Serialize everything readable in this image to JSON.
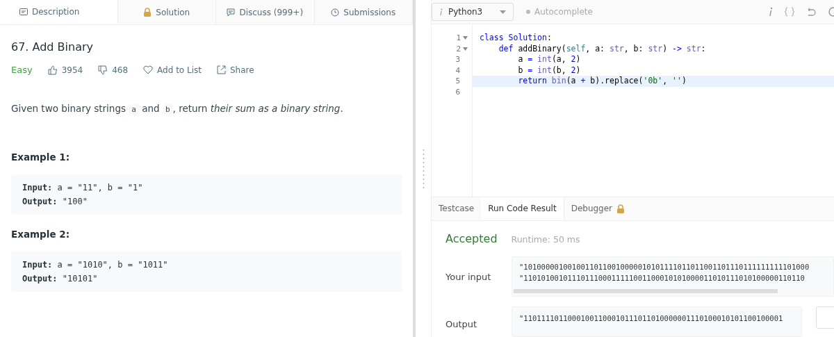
{
  "left_tabs": [
    {
      "label": "Description",
      "selected": true
    },
    {
      "label": "Solution",
      "selected": false
    },
    {
      "label": "Discuss (999+)",
      "selected": false
    },
    {
      "label": "Submissions",
      "selected": false
    }
  ],
  "problem": {
    "title": "67. Add Binary",
    "difficulty": "Easy",
    "likes": "3954",
    "dislikes": "468",
    "add_to_list": "Add to List",
    "share": "Share",
    "description": [
      {
        "kind": "text",
        "t": "Given two binary strings "
      },
      {
        "kind": "code",
        "t": "a"
      },
      {
        "kind": "text",
        "t": " and "
      },
      {
        "kind": "code",
        "t": "b"
      },
      {
        "kind": "text",
        "t": ", return "
      },
      {
        "kind": "italic",
        "t": "their sum as a binary string"
      },
      {
        "kind": "text",
        "t": "."
      }
    ],
    "examples": [
      {
        "title": "Example 1:",
        "lines": [
          {
            "label": "Input:",
            "value": " a = \"11\", b = \"1\""
          },
          {
            "label": "Output:",
            "value": " \"100\""
          }
        ]
      },
      {
        "title": "Example 2:",
        "lines": [
          {
            "label": "Input:",
            "value": " a = \"1010\", b = \"1011\""
          },
          {
            "label": "Output:",
            "value": " \"10101\""
          }
        ]
      }
    ]
  },
  "editor_toolbar": {
    "language": "Python3",
    "autocomplete": "Autocomplete"
  },
  "code_lines": [
    {
      "number": "1",
      "foldable": true,
      "highlighted": false,
      "tokens": [
        {
          "kind": "kw",
          "t": "class "
        },
        {
          "kind": "kw",
          "t": "Solution"
        },
        {
          "kind": "plain",
          "t": ":"
        }
      ]
    },
    {
      "number": "2",
      "foldable": true,
      "highlighted": false,
      "tokens": [
        {
          "kind": "kw",
          "t": "    def "
        },
        {
          "kind": "plain",
          "t": "addBinary("
        },
        {
          "kind": "var",
          "t": "self"
        },
        {
          "kind": "plain",
          "t": ", a: "
        },
        {
          "kind": "builtin",
          "t": "str"
        },
        {
          "kind": "plain",
          "t": ", b: "
        },
        {
          "kind": "builtin",
          "t": "str"
        },
        {
          "kind": "plain",
          "t": ") "
        },
        {
          "kind": "kw",
          "t": "->"
        },
        {
          "kind": "builtin",
          "t": " str"
        },
        {
          "kind": "plain",
          "t": ":"
        }
      ]
    },
    {
      "number": "3",
      "foldable": false,
      "highlighted": false,
      "tokens": [
        {
          "kind": "plain",
          "t": "        a "
        },
        {
          "kind": "kw",
          "t": "="
        },
        {
          "kind": "builtin",
          "t": " int"
        },
        {
          "kind": "plain",
          "t": "(a, "
        },
        {
          "kind": "num",
          "t": "2"
        },
        {
          "kind": "plain",
          "t": ")"
        }
      ]
    },
    {
      "number": "4",
      "foldable": false,
      "highlighted": false,
      "tokens": [
        {
          "kind": "plain",
          "t": "        b "
        },
        {
          "kind": "kw",
          "t": "="
        },
        {
          "kind": "builtin",
          "t": " int"
        },
        {
          "kind": "plain",
          "t": "(b, "
        },
        {
          "kind": "num",
          "t": "2"
        },
        {
          "kind": "plain",
          "t": ")"
        }
      ]
    },
    {
      "number": "5",
      "foldable": false,
      "highlighted": true,
      "tokens": [
        {
          "kind": "kw",
          "t": "        return "
        },
        {
          "kind": "builtin",
          "t": "bin"
        },
        {
          "kind": "plain",
          "t": "(a "
        },
        {
          "kind": "kw",
          "t": "+"
        },
        {
          "kind": "plain",
          "t": " b).replace("
        },
        {
          "kind": "str",
          "t": "'0b'"
        },
        {
          "kind": "plain",
          "t": ", "
        },
        {
          "kind": "str",
          "t": "''"
        },
        {
          "kind": "plain",
          "t": ")"
        }
      ]
    },
    {
      "number": "6",
      "foldable": false,
      "highlighted": false
    }
  ],
  "console_tabs": [
    {
      "label": "Testcase",
      "locked": false,
      "selected": false
    },
    {
      "label": "Run Code Result",
      "locked": false,
      "selected": true
    },
    {
      "label": "Debugger",
      "locked": true,
      "selected": false
    }
  ],
  "result": {
    "status": "Accepted",
    "runtime": "Runtime: 50 ms",
    "input_label": "Your input",
    "input_lines": [
      "\"10100000100100110110010000010101111011011001101110111111111101000",
      "\"1101010010111011100011111001100010101000011010111010100000110110"
    ],
    "output_label": "Output",
    "output": "\"11011110110001001100010111011010000001110100010101100100001"
  }
}
